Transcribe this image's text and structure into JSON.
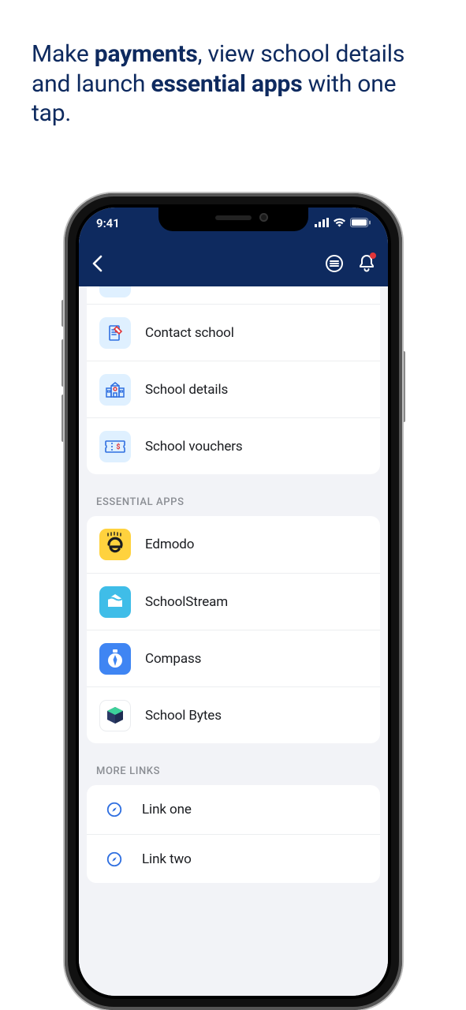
{
  "headline": {
    "p1": "Make ",
    "b1": "payments",
    "p2": ", view school details and launch ",
    "b2": "essential apps",
    "p3": " with one tap."
  },
  "status": {
    "time": "9:41"
  },
  "sections": {
    "school": {
      "items": [
        {
          "label": "Contact school",
          "icon": "contact"
        },
        {
          "label": "School details",
          "icon": "details"
        },
        {
          "label": "School vouchers",
          "icon": "voucher"
        }
      ]
    },
    "essential": {
      "title": "ESSENTIAL APPS",
      "items": [
        {
          "label": "Edmodo",
          "icon": "edmodo"
        },
        {
          "label": "SchoolStream",
          "icon": "schoolstream"
        },
        {
          "label": "Compass",
          "icon": "compass"
        },
        {
          "label": "School Bytes",
          "icon": "schoolbytes"
        }
      ]
    },
    "more": {
      "title": "MORE LINKS",
      "items": [
        {
          "label": "Link one"
        },
        {
          "label": "Link two"
        }
      ]
    }
  }
}
